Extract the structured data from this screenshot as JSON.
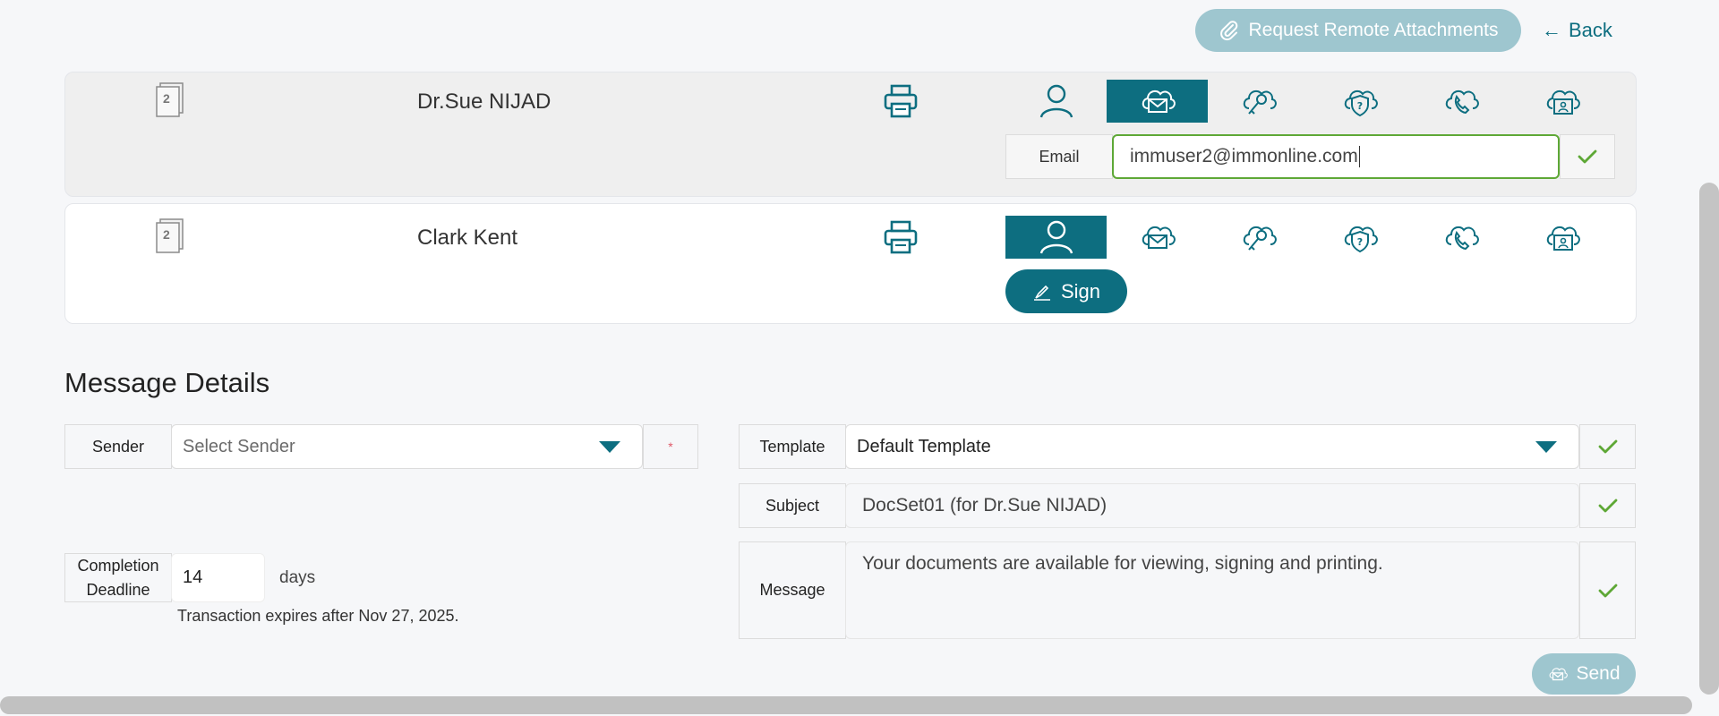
{
  "top_bar": {
    "request_label": "Request Remote Attachments",
    "back_label": "Back",
    "back_arrow": "←"
  },
  "recipients": [
    {
      "doc_count": "2",
      "name": "Dr.Sue NIJAD",
      "active_auth": "email",
      "email_label": "Email",
      "email_value": "immuser2@immonline.com"
    },
    {
      "doc_count": "2",
      "name": "Clark Kent",
      "active_auth": "in-person",
      "sign_label": "Sign"
    }
  ],
  "auth_methods": [
    "person-icon",
    "email-cloud-icon",
    "key-cloud-icon",
    "shield-question-icon",
    "phone-cloud-icon",
    "id-card-cloud-icon"
  ],
  "message_details": {
    "title": "Message Details",
    "sender_label": "Sender",
    "sender_placeholder": "Select Sender",
    "required_marker": "*",
    "template_label": "Template",
    "template_value": "Default Template",
    "subject_label": "Subject",
    "subject_value": "DocSet01 (for Dr.Sue NIJAD)",
    "message_label": "Message",
    "message_value": "Your documents are available for viewing, signing and printing.",
    "deadline_label_1": "Completion",
    "deadline_label_2": "Deadline",
    "deadline_value": "14",
    "deadline_unit": "days",
    "expires_text": "Transaction expires after Nov 27, 2025."
  },
  "send_label": "Send",
  "colors": {
    "brand": "#0d6e80",
    "brand_muted": "#9ec6cf",
    "check": "#5ea836"
  }
}
